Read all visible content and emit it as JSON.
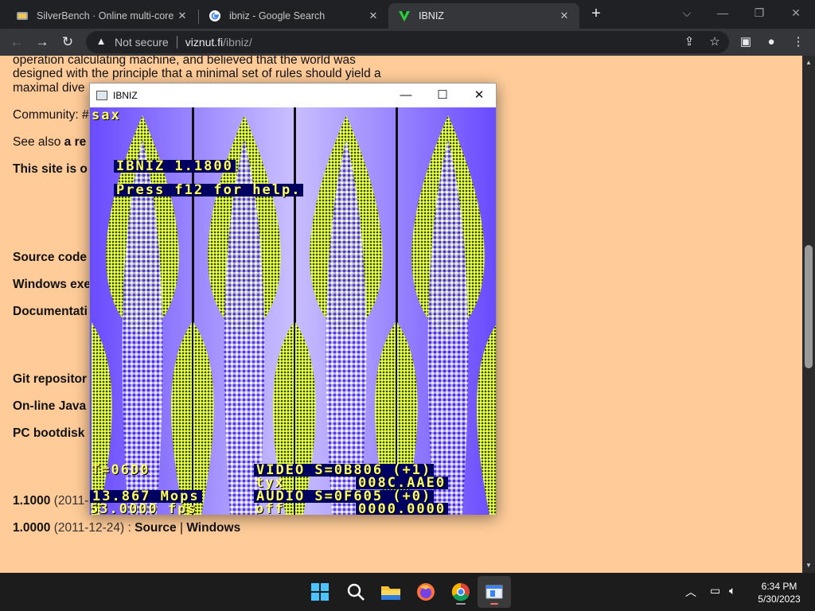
{
  "browser": {
    "tabs": [
      {
        "title": "SilverBench · Online multi-core C",
        "close": "✕"
      },
      {
        "title": "ibniz - Google Search",
        "close": "✕"
      },
      {
        "title": "IBNIZ",
        "close": "✕"
      }
    ],
    "new_tab": "+",
    "window_controls": {
      "chevron": "⌵",
      "minimize": "—",
      "restore": "❐",
      "close": "✕"
    },
    "nav": {
      "back": "←",
      "forward": "→",
      "reload": "↻"
    },
    "omnibox": {
      "security_label": "Not secure",
      "host": "viznut.fi",
      "path": "/ibniz/"
    }
  },
  "page": {
    "intro_line1": "operation calculating machine, and believed that the world was",
    "intro_line2": "designed with the principle that a minimal set of rules should yield a",
    "intro_line3": "maximal dive",
    "community": "Community: #",
    "see_also_prefix": "See also ",
    "see_also_bold": "a re",
    "site_note": "This site is o",
    "source_code": "Source code",
    "windows_exe": "Windows exe",
    "documentation": "Documentati",
    "git_repo": "Git repositor",
    "online_js": "On-line Java",
    "pc_bootdisk": "PC bootdisk",
    "release_1100_version": "1.1000",
    "release_1100_date": " (2011-",
    "release_1000_version": "1.0000",
    "release_1000_date": " (2011-12-24) : ",
    "release_1000_source": "Source",
    "release_1000_sep": " | ",
    "release_1000_windows": "Windows"
  },
  "ibniz_window": {
    "title": "IBNIZ",
    "controls": {
      "minimize": "—",
      "maximize": "☐",
      "close": "✕"
    },
    "osd": {
      "mode": "sax",
      "version": "IBNIZ 1.1800",
      "help": "Press f12 for help.",
      "time": "T=06D0",
      "video": "VIDEO S=0B806 (+1)",
      "tyx_label": "tyx",
      "tyx_value": "008C.AAE0",
      "mops": "13.867 Mops",
      "audio": "AUDIO S=0F605 (+0)",
      "fps": "53.0000 fps",
      "off_label": "off",
      "off_value": "0000.0000"
    }
  },
  "taskbar": {
    "time": "6:34 PM",
    "date": "5/30/2023"
  },
  "colors": {
    "page_bg": "#ffcc99",
    "osd_yellow": "#ffff66",
    "visual_green": "#a8d400",
    "visual_purple": "#6a4bff"
  }
}
